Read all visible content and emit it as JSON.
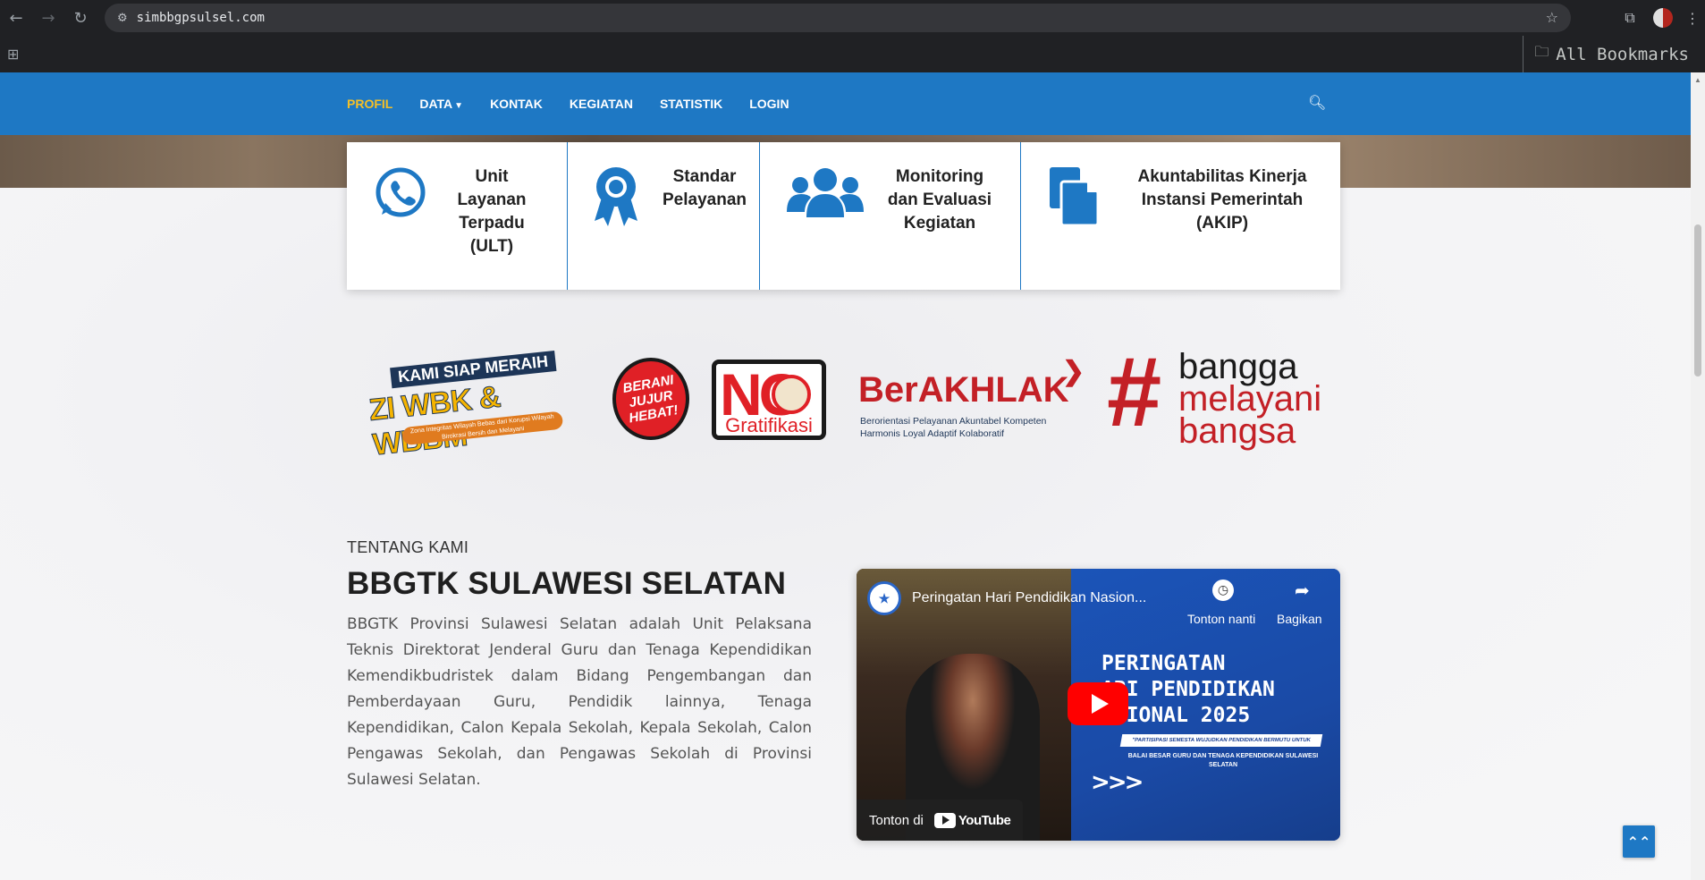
{
  "browser": {
    "url": "simbbgpsulsel.com",
    "bookmarks_label": "All Bookmarks",
    "icons": {
      "back": "arrow-left-icon",
      "forward": "arrow-right-icon",
      "reload": "reload-icon",
      "site_info": "tune-icon",
      "star": "star-icon",
      "extensions": "puzzle-icon",
      "menu": "kebab-icon",
      "apps": "apps-grid-icon",
      "folder": "folder-icon"
    }
  },
  "nav": {
    "items": [
      {
        "label": "PROFIL",
        "active": true
      },
      {
        "label": "DATA",
        "has_caret": true
      },
      {
        "label": "KONTAK"
      },
      {
        "label": "KEGIATAN"
      },
      {
        "label": "STATISTIK"
      },
      {
        "label": "LOGIN"
      }
    ],
    "search_icon": "search-icon",
    "active_color": "#f6c026",
    "bar_color": "#1e78c4"
  },
  "services": [
    {
      "title": "Unit Layanan Terpadu (ULT)",
      "icon": "whatsapp-icon"
    },
    {
      "title": "Standar Pelayanan",
      "icon": "award-ribbon-icon"
    },
    {
      "title": "Monitoring dan Evaluasi Kegiatan",
      "icon": "users-group-icon"
    },
    {
      "title": "Akuntabilitas Kinerja Instansi Pemerintah (AKIP)",
      "icon": "files-icon"
    }
  ],
  "logos": {
    "zi": {
      "line1": "KAMI SIAP MERAIH",
      "line2": "ZI WBK & WBBM",
      "line3": "Zona Integritas Wilayah Bebas dari Korupsi Wilayah Birokrasi Bersih dan Melayani"
    },
    "berani": {
      "text": "BERANI JUJUR HEBAT!"
    },
    "no_gratifikasi": {
      "no": "NO",
      "word": "Gratifikasi"
    },
    "berakhlak": {
      "title": "BerAKHLAK",
      "sub": "Berorientasi Pelayanan Akuntabel Kompeten Harmonis Loyal Adaptif Kolaboratif"
    },
    "bangga": {
      "hash": "#",
      "w1": "bangga",
      "w2": "melayani",
      "w3": "bangsa"
    }
  },
  "about": {
    "eyebrow": "TENTANG KAMI",
    "title": "BBGTK SULAWESI SELATAN",
    "text": "BBGTK Provinsi Sulawesi Selatan adalah Unit Pelaksana Teknis Direktorat Jenderal Guru dan Tenaga Kependidikan Kemendikbudristek dalam Bidang Pengembangan dan Pemberdayaan Guru, Pendidik lainnya, Tenaga Kependidikan, Calon Kepala Sekolah, Kepala Sekolah, Calon Pengawas Sekolah, dan Pengawas Sekolah di Provinsi Sulawesi Selatan."
  },
  "video": {
    "title": "Peringatan Hari Pendidikan Nasion...",
    "watch_later": "Tonton nanti",
    "share": "Bagikan",
    "banner_line1": "PERINGATAN",
    "banner_line2": "ARI PENDIDIKAN",
    "banner_line3": "ASIONAL 2025",
    "banner_sub": "\"PARTISIPASI SEMESTA WUJUDKAN PENDIDIKAN BERMUTU UNTUK SEMUA\"",
    "banner_sub2": "BALAI BESAR GURU DAN TENAGA KEPENDIDIKAN SULAWESI SELATAN",
    "arrows": ">>>",
    "watch_on": "Tonton di",
    "youtube": "YouTube"
  },
  "back_to_top_icon": "double-chevron-up-icon"
}
